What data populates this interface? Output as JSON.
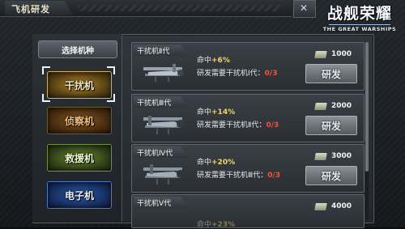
{
  "header": {
    "title": "飞机研发",
    "close_icon": "close-icon"
  },
  "logo": {
    "cn": "战舰荣耀",
    "en": "THE GREAT WARSHIPS"
  },
  "sidebar": {
    "heading": "选择机种",
    "items": [
      {
        "label": "干扰机",
        "selected": true,
        "color": "#b58a2c"
      },
      {
        "label": "侦察机",
        "selected": false,
        "color": "#8a5a22"
      },
      {
        "label": "救援机",
        "selected": false,
        "color": "#6e8a2c"
      },
      {
        "label": "电子机",
        "selected": false,
        "color": "#2c5aa8"
      }
    ]
  },
  "planes": [
    {
      "name": "干扰机Ⅱ代",
      "hit_label": "命中",
      "hit_value": "+6%",
      "req_text": "研发需要干扰机Ⅰ代：",
      "req_progress": "0/3",
      "cost": "1000",
      "button": "研发"
    },
    {
      "name": "干扰机Ⅲ代",
      "hit_label": "命中",
      "hit_value": "+14%",
      "req_text": "研发需要干扰机Ⅱ代：",
      "req_progress": "0/3",
      "cost": "2000",
      "button": "研发"
    },
    {
      "name": "干扰机Ⅳ代",
      "hit_label": "命中",
      "hit_value": "+20%",
      "req_text": "研发需要干扰机Ⅲ代：",
      "req_progress": "0/3",
      "cost": "3000",
      "button": "研发"
    },
    {
      "name": "干扰机Ⅴ代",
      "hit_label": "命中",
      "hit_value": "+23%",
      "cost": "4000"
    }
  ]
}
